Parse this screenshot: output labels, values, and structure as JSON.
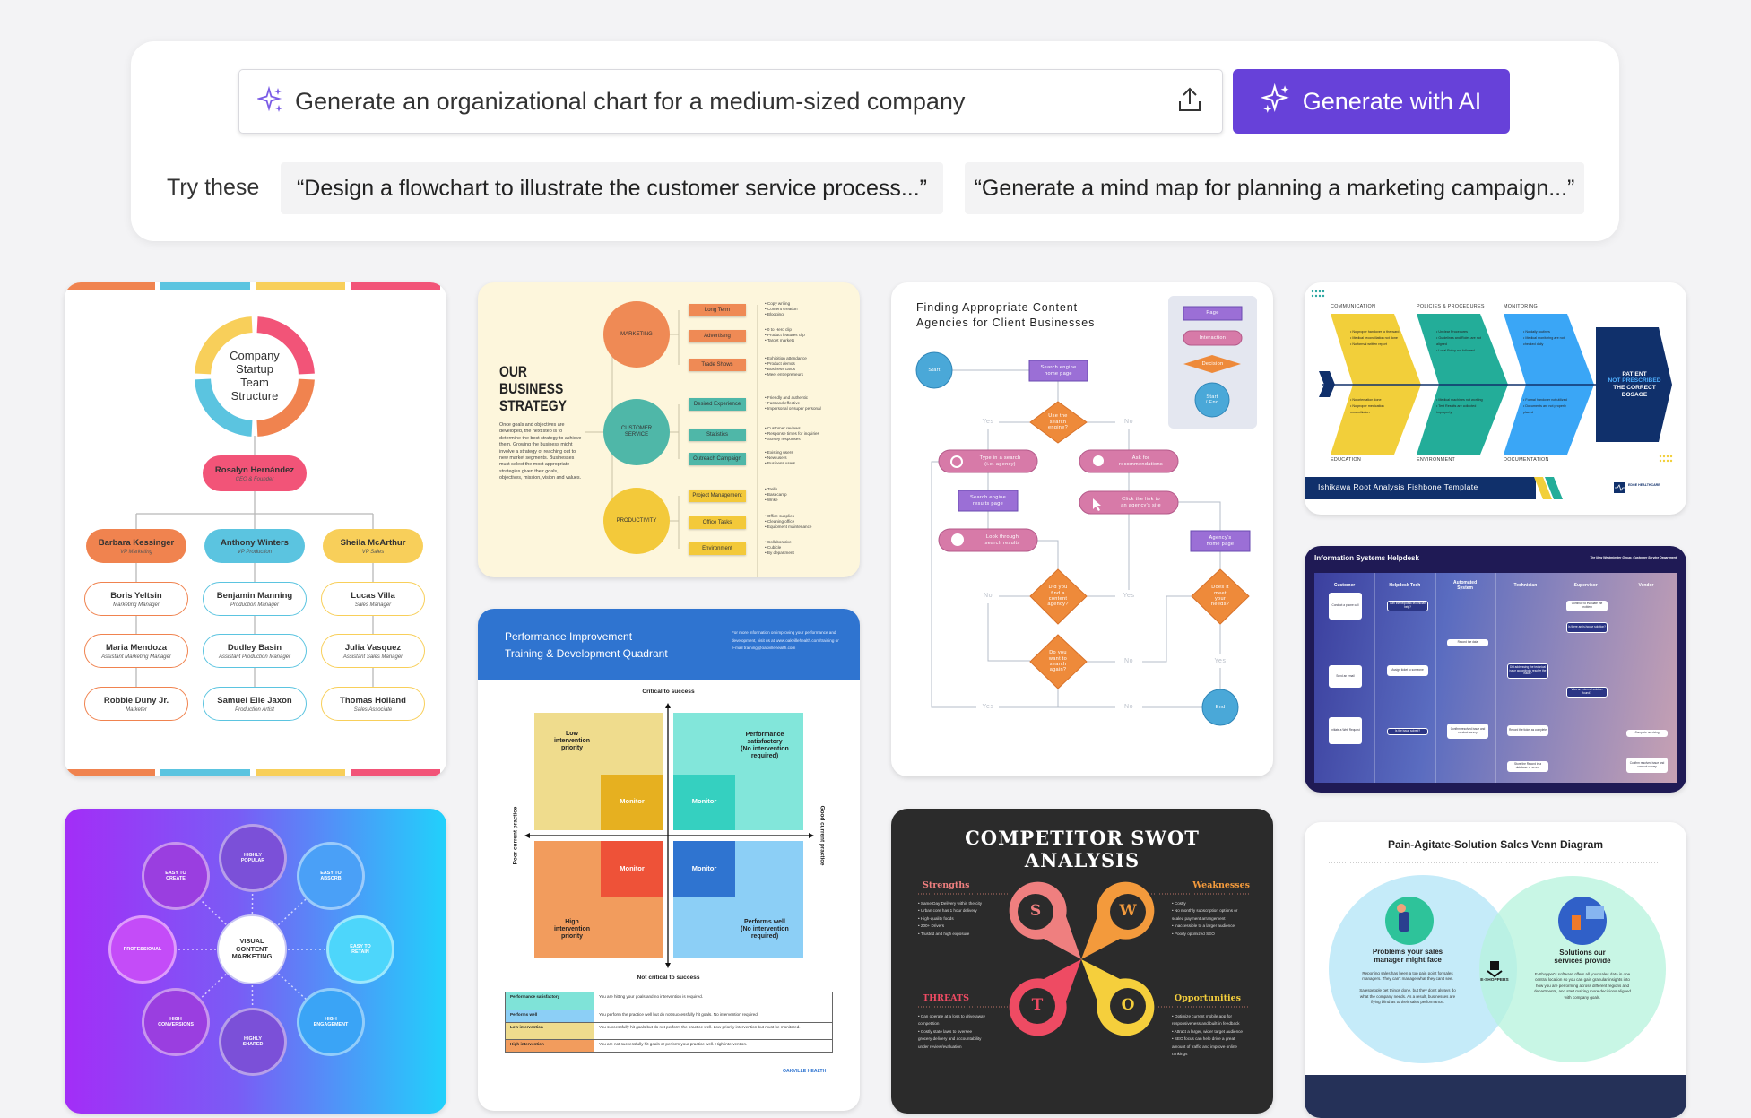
{
  "prompt": {
    "icon": "sparkle-icon",
    "value": "Generate an organizational chart for a medium-sized company",
    "upload_icon": "upload-icon",
    "generate_label": "Generate with AI",
    "accent": "#6741d9"
  },
  "suggestions": {
    "label": "Try these",
    "items": [
      "“Design a flowchart to illustrate the customer service process...”",
      "“Generate a mind map for planning a marketing campaign...”"
    ]
  },
  "templates": {
    "org": {
      "title": "Company\nStartup\nTeam\nStructure",
      "colors": [
        "#f0834f",
        "#5bc4e0",
        "#f8cf5a",
        "#f25478"
      ],
      "ceo": {
        "name": "Rosalyn Hernández",
        "role": "CEO & Founder"
      },
      "columns": [
        {
          "vp": {
            "name": "Barbara Kessinger",
            "role": "VP Marketing"
          },
          "members": [
            {
              "name": "Boris Yeltsin",
              "role": "Marketing Manager"
            },
            {
              "name": "Maria Mendoza",
              "role": "Assistant Marketing Manager"
            },
            {
              "name": "Robbie Duny Jr.",
              "role": "Marketer"
            }
          ]
        },
        {
          "vp": {
            "name": "Anthony Winters",
            "role": "VP Production"
          },
          "members": [
            {
              "name": "Benjamin Manning",
              "role": "Production Manager"
            },
            {
              "name": "Dudley Basin",
              "role": "Assistant Production Manager"
            },
            {
              "name": "Samuel Elle Jaxon",
              "role": "Production Artist"
            }
          ]
        },
        {
          "vp": {
            "name": "Sheila McArthur",
            "role": "VP Sales"
          },
          "members": [
            {
              "name": "Lucas Villa",
              "role": "Sales Manager"
            },
            {
              "name": "Julia Vasquez",
              "role": "Assistant Sales Manager"
            },
            {
              "name": "Thomas Holland",
              "role": "Sales Associate"
            }
          ]
        }
      ]
    },
    "strategy": {
      "title": "OUR\nBUSINESS\nSTRATEGY",
      "paragraph": "Once goals and objectives are developed, the next step is to determine the best strategy to achieve them. Growing the business might involve a strategy of reaching out to new market segments. Businesses must select the most appropriate strategies given their goals, objectives, mission, vision and values.",
      "groups": [
        {
          "name": "MARKETING",
          "color": "#ef8a55",
          "items": [
            {
              "label": "Long Term",
              "bullets": [
                "Copy writing",
                "Content creation",
                "Blogging"
              ]
            },
            {
              "label": "Advertising",
              "bullets": [
                "0 to Hero clip",
                "Product features clip",
                "Target markets"
              ]
            },
            {
              "label": "Trade Shows",
              "bullets": [
                "Exhibition attendance",
                "Product demos",
                "Business cards",
                "Meet entrepreneurs"
              ]
            }
          ]
        },
        {
          "name": "CUSTOMER\nSERVICE",
          "color": "#4fb7a8",
          "items": [
            {
              "label": "Desired Experience",
              "bullets": [
                "Friendly and authentic",
                "Fast and effective",
                "Impersonal or super personal"
              ]
            },
            {
              "label": "Statistics",
              "bullets": [
                "Customer reviews",
                "Response times for inquiries",
                "Survey responses"
              ]
            },
            {
              "label": "Outreach Campaign",
              "bullets": [
                "Existing users",
                "New users",
                "Business users"
              ]
            }
          ]
        },
        {
          "name": "PRODUCTIVITY",
          "color": "#f3c93a",
          "items": [
            {
              "label": "Project Management",
              "bullets": [
                "Trello",
                "Basecamp",
                "Wrike"
              ]
            },
            {
              "label": "Office Tasks",
              "bullets": [
                "Office supplies",
                "Cleaning office",
                "Equipment maintenance"
              ]
            },
            {
              "label": "Environment",
              "bullets": [
                "Collaborative",
                "Cubicle",
                "By department"
              ]
            }
          ]
        }
      ]
    },
    "flowchart": {
      "title": "Finding Appropriate Content\nAgencies for Client Businesses",
      "legend": {
        "page": "Page",
        "interaction": "Interaction",
        "decision": "Decision",
        "start_end": "Start\n/ End"
      },
      "start": "Start",
      "end": "End",
      "search_home": "Search engine\nhome page",
      "use_engine": "Use the\nsearch\nengine?",
      "type_search": "Type in a search\n(i.e. agency)",
      "ask_recs": "Ask for\nrecommendations",
      "results_page": "Search engine\nresults page",
      "click_link": "Click the link to\nan agency's site",
      "look_through": "Look through\nsearch results",
      "agency_home": "Agency's\nhome page",
      "found_agency": "Did you\nfind a\ncontent\nagency?",
      "meet_needs": "Does it\nmeet\nyour\nneeds?",
      "search_again": "Do you\nwant to\nsearch\nagain?",
      "yes": "Yes",
      "no": "No"
    },
    "fishbone": {
      "categories_top": [
        {
          "label": "COMMUNICATION",
          "bullets": [
            "No proper handover to the ward",
            "Medical reconciliation not done",
            "No formal written report"
          ]
        },
        {
          "label": "POLICIES & PROCEDURES",
          "bullets": [
            "Unclear Procedures",
            "Guidelines and Roles are not aligned",
            "Local Policy not followed"
          ]
        },
        {
          "label": "MONITORING",
          "bullets": [
            "No daily routines",
            "Medical monitoring are not checked daily"
          ]
        }
      ],
      "categories_bottom": [
        {
          "label": "EDUCATION",
          "bullets": [
            "No orientation done",
            "No proper medication reconciliation"
          ]
        },
        {
          "label": "ENVIRONMENT",
          "bullets": [
            "Medical machines not working",
            "Test Results are collected improperly"
          ]
        },
        {
          "label": "DOCUMENTATION",
          "bullets": [
            "Formal handover not utilized",
            "Documents are not properly placed"
          ]
        }
      ],
      "head_1": "PATIENT",
      "head_2": "NOT PRESCRIBED",
      "head_3": "THE CORRECT DOSAGE",
      "footer": "Ishikawa Root Analysis Fishbone Template",
      "brand": "EDGE HEALTHCARE",
      "colors": [
        "#f2cf3a",
        "#23ad99",
        "#3aa6f6",
        "#10306b"
      ]
    },
    "helpdesk": {
      "title": "Information Systems Helpdesk",
      "org": "The New Westminster Group, Customer Service Department",
      "lanes": [
        "Customer",
        "Helpdesk Tech",
        "Automated\nSystem",
        "Technician",
        "Supervisor",
        "Vendor"
      ],
      "boxes": {
        "phone": "Conduct a phone call",
        "email": "Send an email",
        "web": "Initiate a Web Request",
        "can_help": "Can the helpdesk technician help?",
        "assign": "Assign ticket to someone",
        "solved": "Is the issue solved?",
        "record": "Record the data",
        "confirm": "Confirm resolved issue and conduct survey",
        "resolve": "Did addressing the technical issue accordingly resolve the issue?",
        "complete": "Record the ticket as complete",
        "store": "Store the Record in a database or server",
        "evaluate": "Continue to evaluate the problem",
        "inhouse": "Is there an in-house solution?",
        "external": "Was an external solution found?",
        "servicing": "Complete servicing",
        "vendor_confirm": "Confirm resolved issue and conduct survey"
      }
    },
    "quadrant": {
      "title": "Performance Improvement\nTraining & Development Quadrant",
      "info": "For more information on improving your performance and development, visit us at www.oakvillehealth.com/training or e-mail training@oakvillehealth.com",
      "top_axis": "Critical to success",
      "bottom_axis": "Not critical to success",
      "left_axis": "Poor current practice",
      "right_axis": "Good current practice",
      "tl": "Low\nintervention\npriority",
      "tr": "Performance\nsatisfactory\n(No intervention\nrequired)",
      "bl": "High\nintervention\npriority",
      "br": "Performs well\n(No intervention\nrequired)",
      "monitor": "Monitor",
      "table": [
        {
          "key": "Performance satisfactory",
          "value": "You are hitting your goals and no intervention is required.",
          "color": "#7fe3d8"
        },
        {
          "key": "Performs well",
          "value": "You perform the practice well but do not successfully hit goals. No intervention required.",
          "color": "#8ccff6"
        },
        {
          "key": "Low intervention",
          "value": "You successfully hit goals but do not perform the practice well. Low priority intervention but must be monitored.",
          "color": "#efdc8d"
        },
        {
          "key": "High intervention",
          "value": "You are not successfully hit goals or perform your practice well. High intervention.",
          "color": "#f29c5d"
        }
      ],
      "brand": "OAKVILLE HEALTH"
    },
    "marketing": {
      "center": "VISUAL\nCONTENT\nMARKETING",
      "items": [
        "HIGHLY\nPOPULAR",
        "EASY TO\nCREATE",
        "EASY TO\nABSORB",
        "PROFESSIONAL",
        "EASY TO\nRETAIN",
        "HIGH\nCONVERSIONS",
        "HIGHLY\nSHARED",
        "HIGH\nENGAGEMENT"
      ]
    },
    "swot": {
      "title": "COMPETITOR SWOT ANALYSIS",
      "quadrants": [
        {
          "label": "Strengths",
          "letter": "S",
          "color": "#ef7f7f",
          "bullets": [
            "Same Day Delivery within the city",
            "Urban core has 1 hour delivery",
            "High-quality foods",
            "200+ Drivers",
            "Trusted and high exposure"
          ]
        },
        {
          "label": "Weaknesses",
          "letter": "W",
          "color": "#f39a3c",
          "bullets": [
            "Costly",
            "No monthly subscription options or scaled payment arrangement",
            "Inaccessible to a larger audience",
            "Poorly optimized SEO"
          ]
        },
        {
          "label": "THREATS",
          "letter": "T",
          "color": "#ee4b63",
          "bullets": [
            "Can operate at a loss to drive away competition",
            "Costly state laws to oversee grocery delivery and accountability under review/evaluation"
          ]
        },
        {
          "label": "Opportunities",
          "letter": "O",
          "color": "#f5cf3c",
          "bullets": [
            "Optimize current mobile app for responsiveness and built-in feedback",
            "Attract a larger, wider target audience",
            "SEO focus can help drive a great amount of traffic and improve online rankings"
          ]
        }
      ]
    },
    "venn": {
      "title": "Pain-Agitate-Solution Sales Venn Diagram",
      "left_heading": "Problems your sales\nmanager might face",
      "left_body": "Reporting sales has been a top pain point for sales managers. They can't manage what they can't see.\n\nSalespeople get things done, but they don't always do what the company needs. As a result, businesses are flying blind as to their sales performance.",
      "center": "E-SHOPPERS",
      "right_heading": "Solutions our\nservices provide",
      "right_body": "E-Shopper's software offers all your sales data in one central location so you can gain granular insights into how you are performing across different regions and departments, and start making more decisions aligned with company goals."
    }
  }
}
